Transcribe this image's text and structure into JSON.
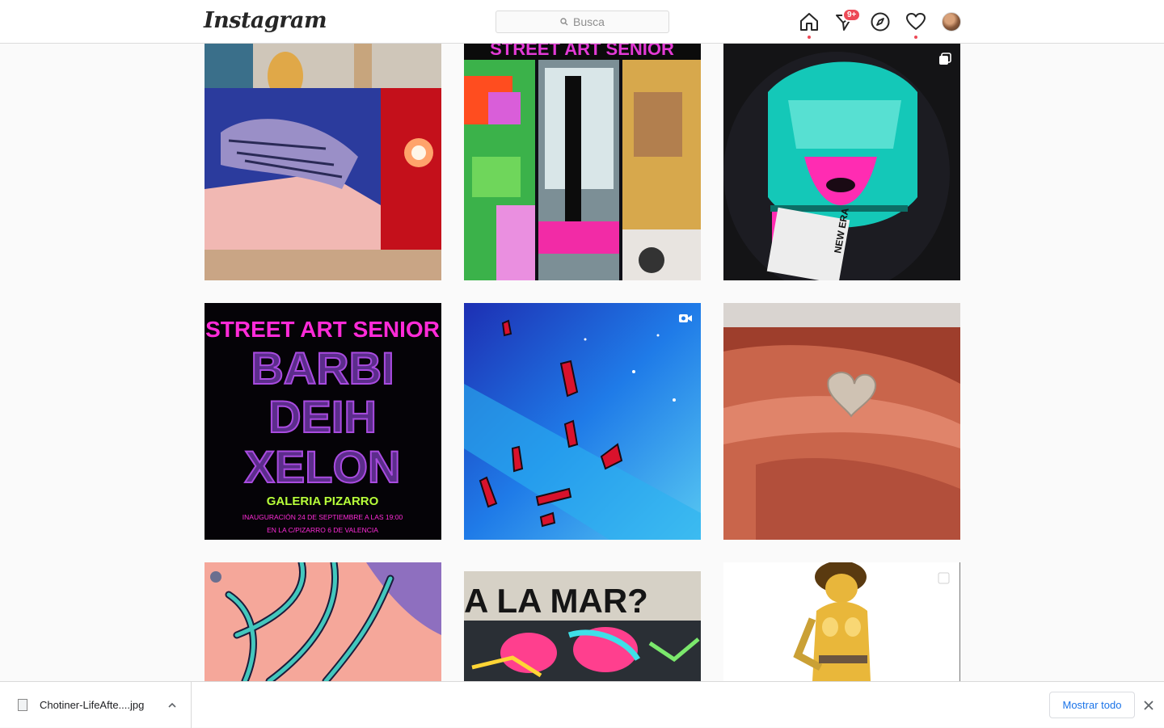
{
  "header": {
    "logo": "Instagram",
    "search_placeholder": "Busca",
    "activity_badge": "9+"
  },
  "nav_icons": [
    "home-icon",
    "direct-icon",
    "explore-icon",
    "heart-icon",
    "avatar"
  ],
  "tiles": [
    {
      "name": "post-1",
      "subject": "painting of fallen figure with red explosion",
      "type": "image"
    },
    {
      "name": "post-2",
      "subject": "street art senior pixelated poster",
      "type": "image",
      "text": "STREET ART SENIOR"
    },
    {
      "name": "post-3",
      "subject": "New Era cap with cyberpunk graphic",
      "type": "carousel"
    },
    {
      "name": "post-4",
      "subject": "exhibition poster",
      "type": "image",
      "poster": {
        "title": "STREET ART SENIOR",
        "names": [
          "BARBI",
          "DEIH",
          "XELON"
        ],
        "venue": "GALERIA PIZARRO",
        "line1": "INAUGURACIÓN 24 DE SEPTIEMBRE A LAS 19:00",
        "line2": "EN LA C/PIZARRO 6 DE VALENCIA"
      }
    },
    {
      "name": "post-5",
      "subject": "blue space painting with red crystals",
      "type": "video"
    },
    {
      "name": "post-6",
      "subject": "heart shaped stone on fingers",
      "type": "image"
    },
    {
      "name": "post-7",
      "subject": "teal roots on pink ground",
      "type": "image"
    },
    {
      "name": "post-8",
      "subject": "graffiti wall",
      "type": "image",
      "text": "A LA MAR?"
    },
    {
      "name": "post-9",
      "subject": "golden robot woman",
      "type": "carousel"
    }
  ],
  "download_bar": {
    "file_name": "Chotiner-LifeAfte....jpg",
    "show_all_label": "Mostrar todo"
  },
  "colors": {
    "accent": "#ed4956",
    "link": "#1a73e8",
    "border": "#dbdbdb"
  }
}
